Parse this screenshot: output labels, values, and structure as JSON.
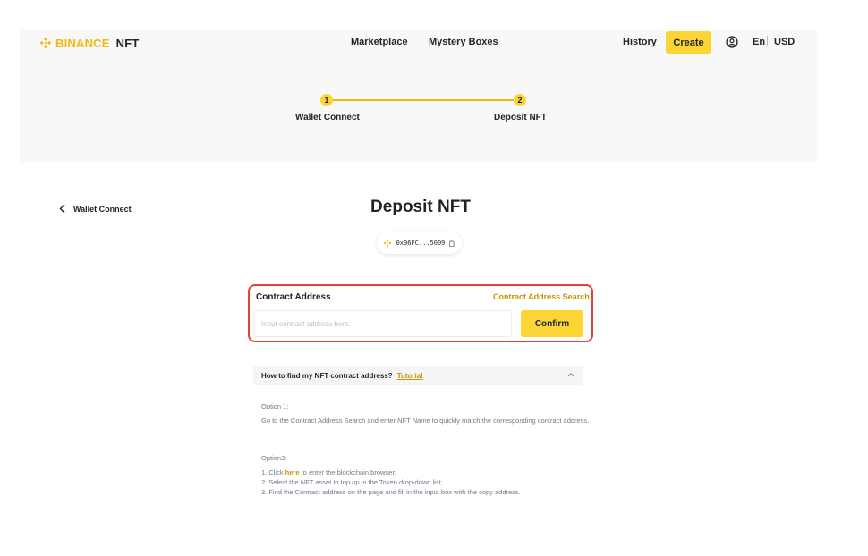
{
  "brand": {
    "name_part1": "BINANCE",
    "name_part2": "NFT",
    "accent_color": "#f0b90b",
    "button_color": "#fcd535",
    "highlight_color": "#e8412f"
  },
  "header": {
    "nav": [
      "Marketplace",
      "Mystery Boxes"
    ],
    "history_label": "History",
    "create_label": "Create",
    "user_icon": "user-circle-icon",
    "language": "En",
    "currency": "USD"
  },
  "stepper": {
    "steps": [
      {
        "number": "1",
        "label": "Wallet Connect"
      },
      {
        "number": "2",
        "label": "Deposit NFT"
      }
    ]
  },
  "main": {
    "back_label": "Wallet Connect",
    "title": "Deposit NFT",
    "wallet_address": "0x96FC...5009",
    "contract": {
      "label": "Contract Address",
      "search_link": "Contract Address Search",
      "input_placeholder": "Input contract address here.",
      "input_value": "",
      "confirm_label": "Confirm"
    },
    "faq": {
      "question": "How to find my NFT contract address?",
      "tutorial_link": "Tutorial",
      "option1_title": "Option 1:",
      "option1_body": "Go to the Contract Address Search and enter NFT Name to quickly match the corresponding contract address.",
      "option2_title": "Option2:",
      "option2_step1_prefix": "1. Click ",
      "option2_step1_link": "here",
      "option2_step1_suffix": " to enter the blockchain browser;",
      "option2_step2": "2. Select the NFT asset to top up in the Token drop-down list;",
      "option2_step3": "3. Find the Contract address on the page and fill in the input box with the copy address."
    }
  }
}
